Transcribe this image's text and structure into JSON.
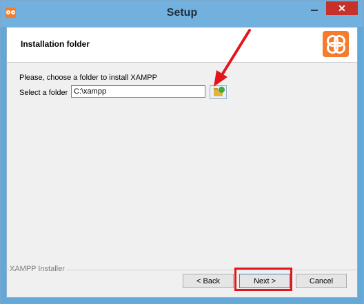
{
  "window": {
    "title": "Setup",
    "close_glyph": "✕"
  },
  "header": {
    "title": "Installation folder"
  },
  "body": {
    "intro": "Please, choose a folder to install XAMPP",
    "folder_label": "Select a folder",
    "folder_value": "C:\\xampp"
  },
  "footer": {
    "group_label": "XAMPP Installer",
    "back_label": "< Back",
    "next_label": "Next >",
    "cancel_label": "Cancel"
  },
  "icons": {
    "app": "xampp-logo-icon",
    "browse": "folder-browse-icon"
  },
  "colors": {
    "titlebar": "#72b0de",
    "close": "#c7312c",
    "brand": "#f47c2c",
    "annotation": "#e2161c"
  }
}
